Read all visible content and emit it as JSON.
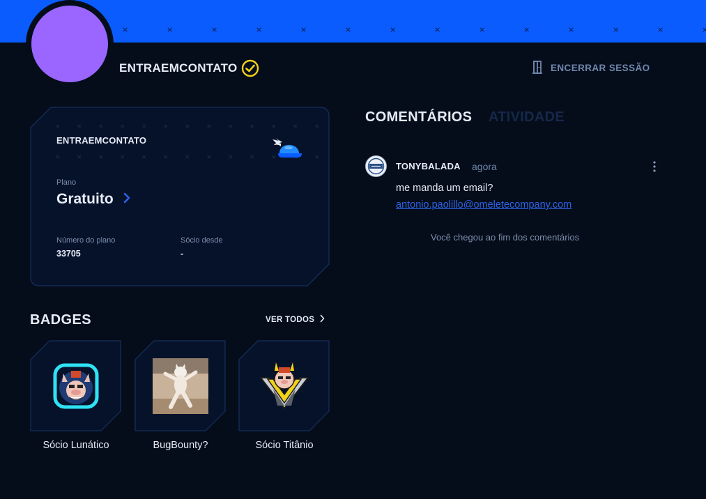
{
  "header": {
    "username": "ENTRAEMCONTATO",
    "logout_label": "ENCERRAR SESSÃO"
  },
  "plan_card": {
    "username": "ENTRAEMCONTATO",
    "plan_label": "Plano",
    "plan_value": "Gratuito",
    "plan_number_label": "Número do plano",
    "plan_number_value": "33705",
    "member_since_label": "Sócio desde",
    "member_since_value": "-"
  },
  "badges": {
    "title": "BADGES",
    "see_all_label": "VER TODOS",
    "items": [
      {
        "name": "Sócio Lunático",
        "icon": "lunatic-pig-badge-icon"
      },
      {
        "name": "BugBounty?",
        "icon": "dancing-cat-photo"
      },
      {
        "name": "Sócio Titânio",
        "icon": "titanium-pig-badge-icon"
      }
    ]
  },
  "tabs": [
    {
      "label": "COMENTÁRIOS",
      "active": true
    },
    {
      "label": "ATIVIDADE",
      "active": false
    }
  ],
  "comments": [
    {
      "author": "TONYBALADA",
      "time": "agora",
      "text": "me manda um email?",
      "link": "antonio.paolillo@omeletecompany.com"
    }
  ],
  "end_note": "Você chegou ao fim dos comentários",
  "colors": {
    "accent": "#0a5cff",
    "avatar": "#9a66ff",
    "background": "#050d1a",
    "verified": "#f2d21a",
    "link": "#2b63e6"
  }
}
